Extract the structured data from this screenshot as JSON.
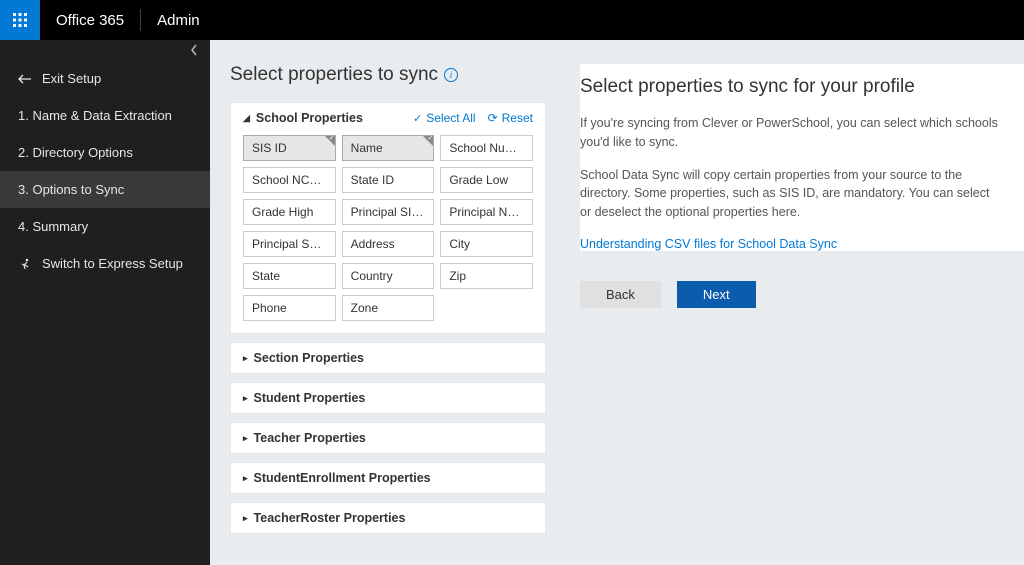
{
  "topbar": {
    "brand": "Office 365",
    "app": "Admin"
  },
  "sidebar": {
    "exit": "Exit Setup",
    "items": [
      "1.  Name & Data Extraction",
      "2.  Directory Options",
      "3.  Options to Sync",
      "4.  Summary"
    ],
    "switch": "Switch to Express Setup"
  },
  "middle": {
    "title": "Select properties to sync",
    "sections": {
      "school": {
        "title": "School Properties",
        "selectAll": "Select All",
        "reset": "Reset",
        "props": [
          "SIS ID",
          "Name",
          "School Number",
          "School NCES_...",
          "State ID",
          "Grade Low",
          "Grade High",
          "Principal SIS ID",
          "Principal Name",
          "Principal Seco...",
          "Address",
          "City",
          "State",
          "Country",
          "Zip",
          "Phone",
          "Zone"
        ]
      },
      "collapsed": [
        "Section Properties",
        "Student Properties",
        "Teacher Properties",
        "StudentEnrollment Properties",
        "TeacherRoster Properties"
      ]
    }
  },
  "right": {
    "title": "Select properties to sync for your profile",
    "p1": "If you're syncing from Clever or PowerSchool, you can select which schools you'd like to sync.",
    "p2": "School Data Sync will copy certain properties from your source to the directory. Some properties, such as SIS ID, are mandatory. You can select or deselect the optional properties here.",
    "link": "Understanding CSV files for School Data Sync",
    "back": "Back",
    "next": "Next"
  }
}
